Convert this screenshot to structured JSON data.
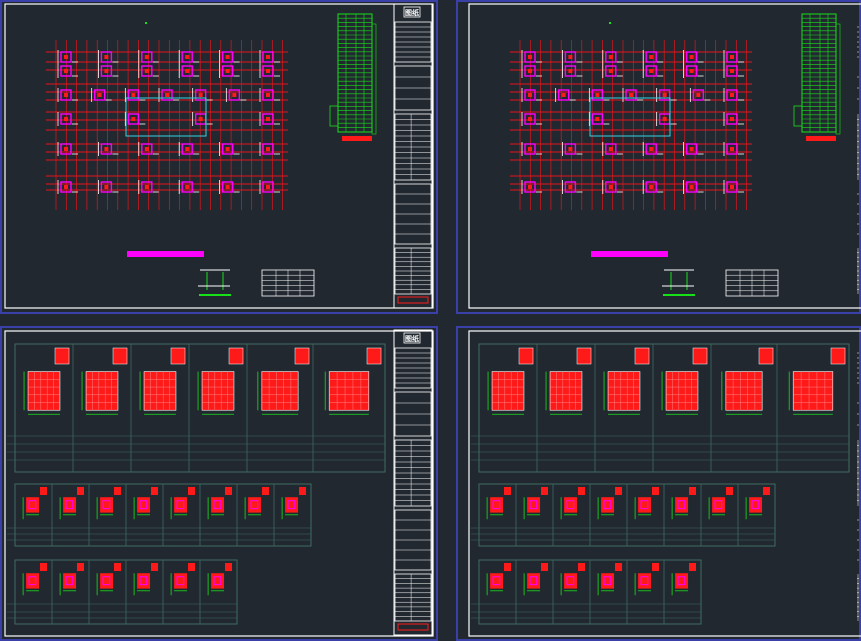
{
  "colors": {
    "background": "#212830",
    "sheet_border": "#3b3fa8",
    "frame": "#ffffff",
    "axis_line": "#e8141b",
    "column": "#ff00ff",
    "rebar": "#ff1a1a",
    "dimension": "#18e018",
    "table_line": "#3e6b62"
  },
  "sheets": [
    {
      "type": "plan",
      "title_stamp": "图纸"
    },
    {
      "type": "plan",
      "title_stamp": ""
    },
    {
      "type": "details",
      "title_stamp": "图纸"
    },
    {
      "type": "details",
      "title_stamp": ""
    }
  ],
  "icons": {
    "plan_sheet": "floor-plan-drawing",
    "detail_sheet": "column-section-details"
  }
}
